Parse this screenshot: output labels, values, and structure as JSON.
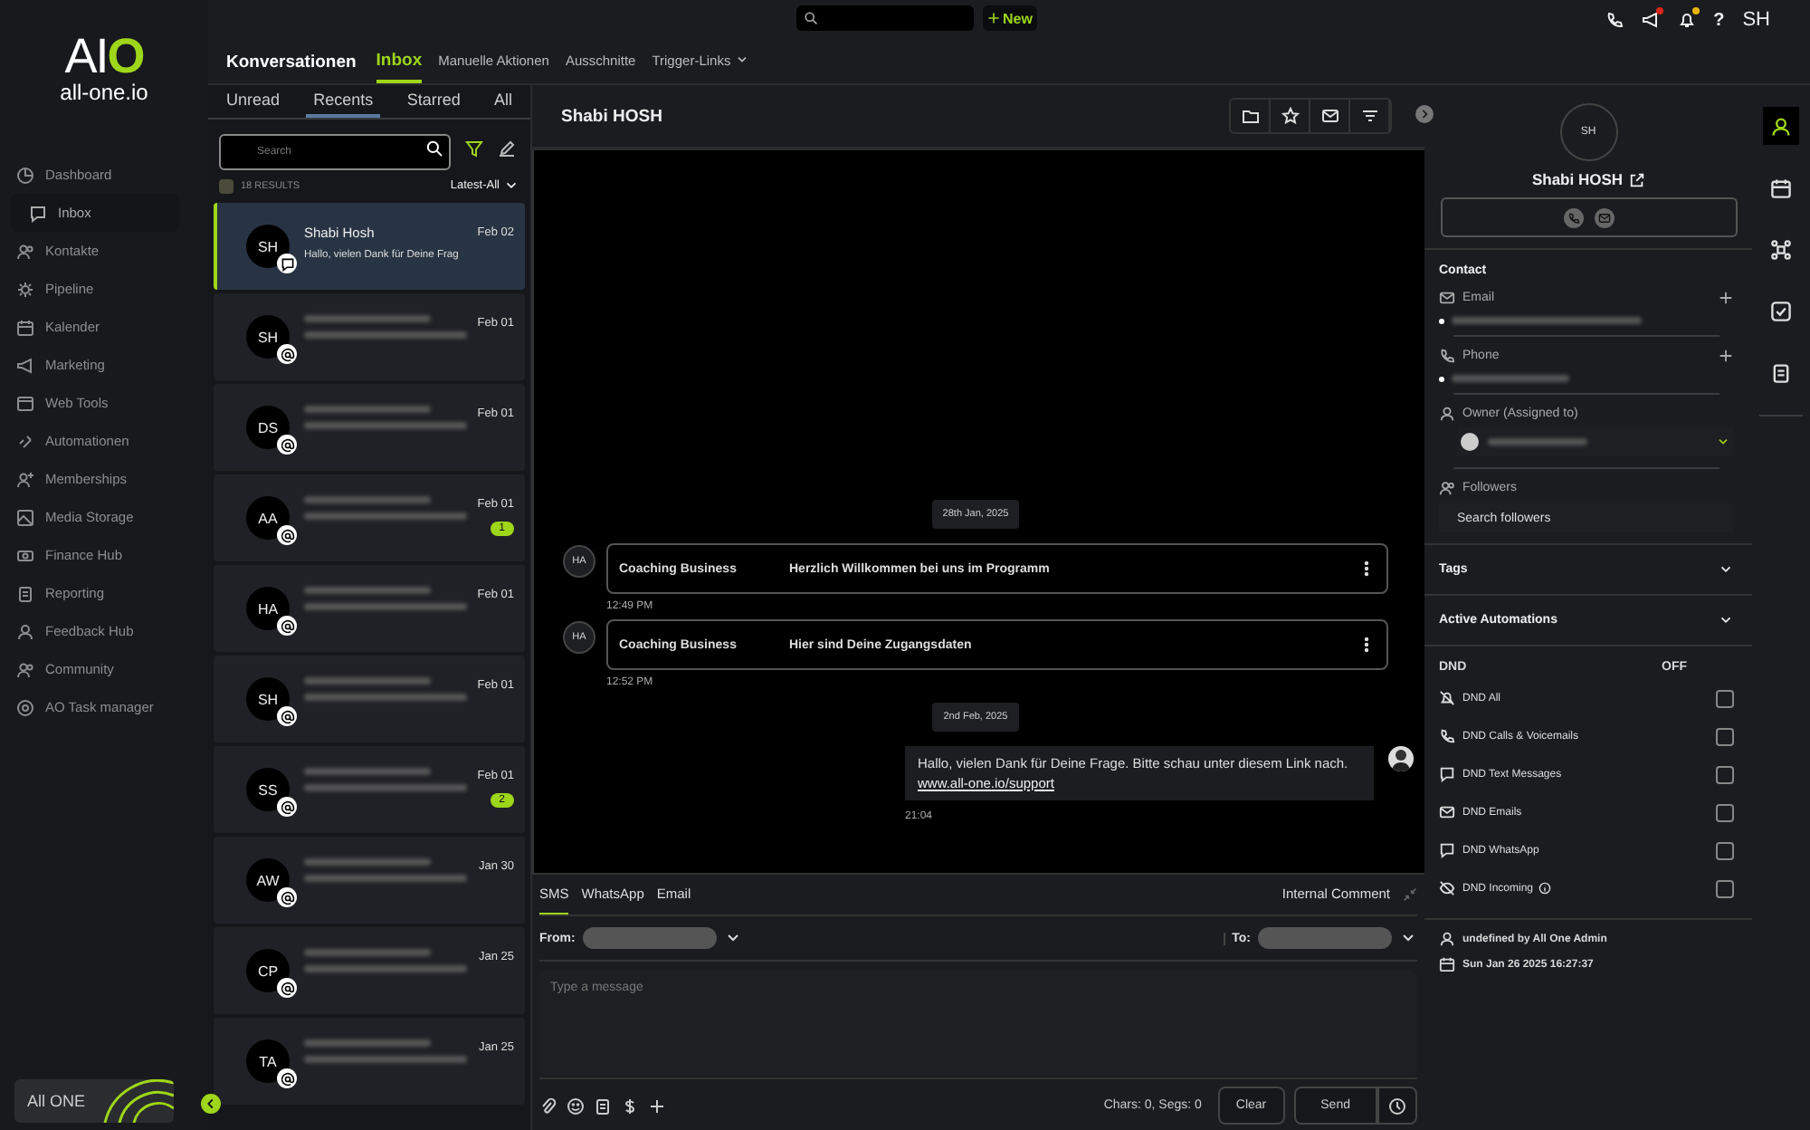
{
  "logo": {
    "mark": "AI",
    "mark_accent": "O",
    "name": "all-one.io"
  },
  "nav": [
    {
      "label": "Dashboard",
      "selected": false,
      "children": [
        {
          "label": "Inbox",
          "selected": true
        }
      ]
    },
    {
      "label": "Kontakte",
      "selected": false
    },
    {
      "label": "Pipeline",
      "selected": false
    },
    {
      "label": "Kalender",
      "selected": false
    },
    {
      "label": "Marketing",
      "selected": false
    },
    {
      "label": "Web Tools",
      "selected": false
    },
    {
      "label": "Automationen",
      "selected": false
    },
    {
      "label": "Memberships",
      "selected": false
    },
    {
      "label": "Media Storage",
      "selected": false
    },
    {
      "label": "Finance Hub",
      "selected": false
    },
    {
      "label": "Reporting",
      "selected": false
    },
    {
      "label": "Feedback Hub",
      "selected": false
    },
    {
      "label": "Community",
      "selected": false
    },
    {
      "label": "AO Task manager",
      "selected": false
    }
  ],
  "brand_card": {
    "label": "All ONE"
  },
  "topbar": {
    "new_button": "New",
    "alerts": [
      {
        "color": "#d9261c"
      },
      {
        "color": "#e8b20e"
      }
    ],
    "help": "?",
    "avatar": "SH"
  },
  "subnav": {
    "title": "Konversationen",
    "tabs": [
      {
        "label": "Inbox",
        "selected": true,
        "dropdown": false
      },
      {
        "label": "Manuelle Aktionen",
        "selected": false,
        "dropdown": false
      },
      {
        "label": "Ausschnitte",
        "selected": false,
        "dropdown": false
      },
      {
        "label": "Trigger-Links",
        "selected": false,
        "dropdown": true
      }
    ]
  },
  "list": {
    "tabs": [
      {
        "label": "Unread",
        "selected": false
      },
      {
        "label": "Recents",
        "selected": true
      },
      {
        "label": "Starred",
        "selected": false
      },
      {
        "label": "All",
        "selected": false
      }
    ],
    "search": {
      "placeholder": "Search"
    },
    "select_all": {
      "checked": false
    },
    "results": "18 RESULTS",
    "sort": "Latest-All",
    "items": [
      {
        "initials": "SH",
        "kind": "chat",
        "name": "Shabi Hosh",
        "preview": "Hallo, vielen Dank für Deine Frag",
        "date": "Feb 02",
        "selected": true
      },
      {
        "initials": "SH",
        "kind": "email",
        "date": "Feb 01",
        "selected": false
      },
      {
        "initials": "DS",
        "kind": "email",
        "date": "Feb 01",
        "selected": false
      },
      {
        "initials": "AA",
        "kind": "email",
        "date": "Feb 01",
        "unread": "1",
        "selected": false
      },
      {
        "initials": "HA",
        "kind": "email",
        "date": "Feb 01",
        "selected": false
      },
      {
        "initials": "SH",
        "kind": "email",
        "date": "Feb 01",
        "selected": false
      },
      {
        "initials": "SS",
        "kind": "email",
        "date": "Feb 01",
        "unread": "2",
        "selected": false
      },
      {
        "initials": "AW",
        "kind": "email",
        "date": "Jan 30",
        "selected": false
      },
      {
        "initials": "CP",
        "kind": "email",
        "date": "Jan 25",
        "selected": false
      },
      {
        "initials": "TA",
        "kind": "email",
        "date": "Jan 25",
        "selected": false
      }
    ]
  },
  "chat": {
    "title": "Shabi HOSH",
    "messages": [
      {
        "kind": "date",
        "text": "28th Jan, 2025"
      },
      {
        "kind": "template",
        "avatar": "HA",
        "sender": "Coaching Business",
        "subject": "Herzlich Willkommen bei uns im Programm",
        "time": "12:49 PM"
      },
      {
        "kind": "template",
        "avatar": "HA",
        "sender": "Coaching Business",
        "subject": "Hier sind Deine Zugangsdaten",
        "time": "12:52 PM"
      },
      {
        "kind": "date",
        "text": "2nd Feb, 2025"
      },
      {
        "kind": "outgoing",
        "text": "Hallo, vielen Dank für Deine Frage. Bitte schau unter diesem Link nach.",
        "link": "www.all-one.io/support",
        "time": "21:04"
      }
    ],
    "composer": {
      "channels": [
        {
          "label": "SMS",
          "selected": true
        },
        {
          "label": "WhatsApp",
          "selected": false
        },
        {
          "label": "Email",
          "selected": false
        }
      ],
      "internal": "Internal Comment",
      "from_label": "From:",
      "to_label": "To:",
      "placeholder": "Type a message",
      "counter": "Chars: 0, Segs: 0",
      "clear": "Clear",
      "send": "Send"
    }
  },
  "contact": {
    "avatar": "SH",
    "name": "Shabi HOSH",
    "section": "Contact",
    "email_label": "Email",
    "phone_label": "Phone",
    "owner_label": "Owner (Assigned to)",
    "followers_label": "Followers",
    "followers_placeholder": "Search followers",
    "collapsibles": [
      {
        "label": "Tags",
        "expanded": false
      },
      {
        "label": "Active Automations",
        "expanded": false
      }
    ],
    "dnd": {
      "label": "DND",
      "status": "OFF",
      "options": [
        {
          "label": "DND All",
          "checked": false,
          "info": false
        },
        {
          "label": "DND Calls & Voicemails",
          "checked": false,
          "info": false
        },
        {
          "label": "DND Text Messages",
          "checked": false,
          "info": false
        },
        {
          "label": "DND Emails",
          "checked": false,
          "info": false
        },
        {
          "label": "DND WhatsApp",
          "checked": false,
          "info": false
        },
        {
          "label": "DND Incoming",
          "checked": false,
          "info": true
        }
      ]
    },
    "created_by": "undefined by All One Admin",
    "created_at": "Sun Jan 26 2025 16:27:37"
  },
  "rail": [
    {
      "selected": true
    },
    {
      "selected": false
    },
    {
      "selected": false
    },
    {
      "selected": false
    },
    {
      "selected": false
    }
  ]
}
